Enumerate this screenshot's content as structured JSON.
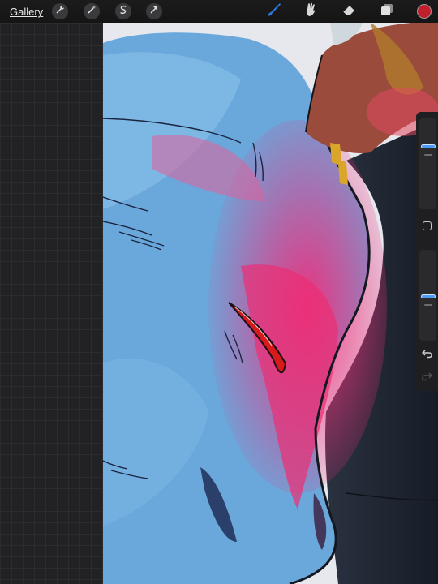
{
  "app": {
    "gallery_label": "Gallery"
  },
  "toolbar": {
    "left_buttons": [
      "wrench-icon",
      "magic-wand-icon",
      "selection-s-icon",
      "transform-arrow-icon"
    ],
    "right_tools": [
      "brush-icon",
      "smudge-icon",
      "eraser-icon",
      "layers-icon"
    ],
    "active_tool": "brush",
    "active_tool_color": "#2b7be4",
    "current_color": "#c21f2c"
  },
  "sidebar": {
    "brush_size_level": 0.7,
    "opacity_level": 0.45,
    "undo_enabled": true,
    "redo_enabled": false
  },
  "canvas": {
    "palette": {
      "sky": "#e7e9ee",
      "fur_blue": "#6aa8dc",
      "magenta": "#e8307a",
      "dark_coat": "#1d2430",
      "eye_red": "#d81a1a"
    }
  }
}
